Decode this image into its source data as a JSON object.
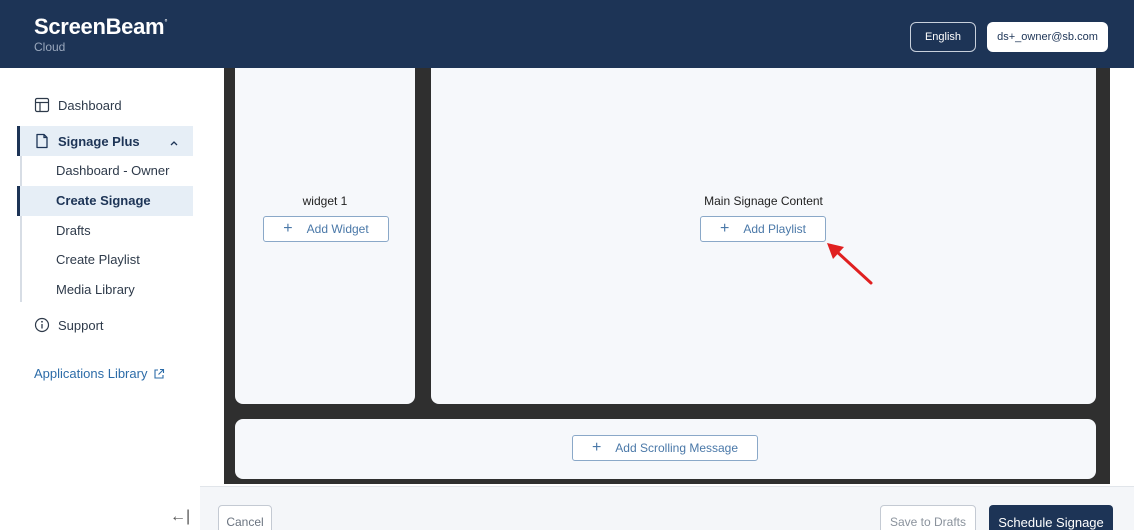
{
  "header": {
    "brand": "ScreenBeam",
    "brand_mark": "°",
    "product": "Cloud",
    "language": "English",
    "user_email": "ds+_owner@sb.com"
  },
  "sidebar": {
    "dashboard": "Dashboard",
    "signage_plus": "Signage Plus",
    "sub_items": [
      "Dashboard - Owner",
      "Create Signage",
      "Drafts",
      "Create Playlist",
      "Media Library"
    ],
    "support": "Support",
    "applications_library": "Applications Library",
    "collapse_icon": "←|"
  },
  "canvas": {
    "widget_label": "widget 1",
    "add_widget": "Add Widget",
    "main_label": "Main Signage Content",
    "add_playlist": "Add Playlist",
    "add_scrolling": "Add Scrolling Message"
  },
  "footer": {
    "cancel": "Cancel",
    "save_drafts": "Save to Drafts",
    "schedule": "Schedule Signage"
  },
  "colors": {
    "header_bg": "#1d3456",
    "accent": "#4a78a8",
    "canvas_bg": "#2f2f2f",
    "annotation_arrow": "#e02020"
  }
}
